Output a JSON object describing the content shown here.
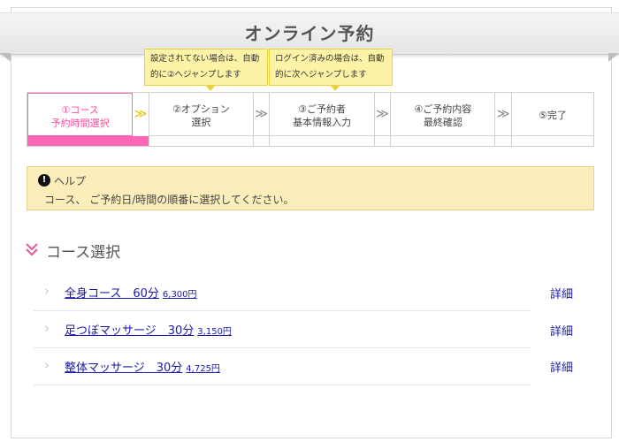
{
  "header": {
    "title": "オンライン予約"
  },
  "tooltips": [
    {
      "line1": "設定されてない場合は、自動",
      "line2": "的に②へジャンプします"
    },
    {
      "line1": "ログイン済みの場合は、自動",
      "line2": "的に次へジャンプします"
    }
  ],
  "steps": [
    {
      "line1": "①コース",
      "line2": "予約時間選択"
    },
    {
      "line1": "②オプション",
      "line2": "選択"
    },
    {
      "line1": "③ご予約者",
      "line2": "基本情報入力"
    },
    {
      "line1": "④ご予約内容",
      "line2": "最終確認"
    },
    {
      "line1": "⑤完了",
      "line2": ""
    }
  ],
  "step_arrow": "≫",
  "help": {
    "icon": "!",
    "title": "ヘルプ",
    "text": "コース、 ご予約日/時間の順番に選択してください。"
  },
  "section": {
    "title": "コース選択",
    "icon": "double-chevron-down-icon"
  },
  "courses": [
    {
      "name": "全身コース　60分",
      "price": "6,300円",
      "detail": "詳細"
    },
    {
      "name": "足つぼマッサージ　30分",
      "price": "3,150円",
      "detail": "詳細"
    },
    {
      "name": "整体マッサージ　30分",
      "price": "4,725円",
      "detail": "詳細"
    }
  ],
  "colors": {
    "accent": "#ff66b3",
    "link": "#1a1aa6",
    "help_bg": "#fbeebb",
    "tooltip_bg": "#fdf3a6"
  }
}
